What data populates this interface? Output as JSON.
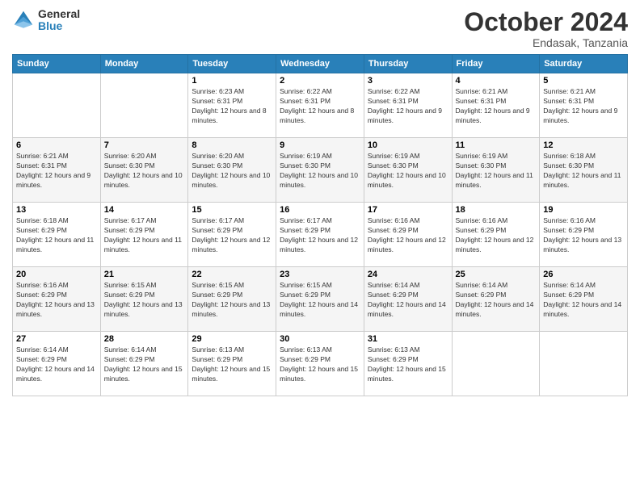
{
  "logo": {
    "text_general": "General",
    "text_blue": "Blue"
  },
  "header": {
    "title": "October 2024",
    "subtitle": "Endasak, Tanzania"
  },
  "weekdays": [
    "Sunday",
    "Monday",
    "Tuesday",
    "Wednesday",
    "Thursday",
    "Friday",
    "Saturday"
  ],
  "weeks": [
    [
      {
        "day": "",
        "info": ""
      },
      {
        "day": "",
        "info": ""
      },
      {
        "day": "1",
        "info": "Sunrise: 6:23 AM\nSunset: 6:31 PM\nDaylight: 12 hours and 8 minutes."
      },
      {
        "day": "2",
        "info": "Sunrise: 6:22 AM\nSunset: 6:31 PM\nDaylight: 12 hours and 8 minutes."
      },
      {
        "day": "3",
        "info": "Sunrise: 6:22 AM\nSunset: 6:31 PM\nDaylight: 12 hours and 9 minutes."
      },
      {
        "day": "4",
        "info": "Sunrise: 6:21 AM\nSunset: 6:31 PM\nDaylight: 12 hours and 9 minutes."
      },
      {
        "day": "5",
        "info": "Sunrise: 6:21 AM\nSunset: 6:31 PM\nDaylight: 12 hours and 9 minutes."
      }
    ],
    [
      {
        "day": "6",
        "info": "Sunrise: 6:21 AM\nSunset: 6:31 PM\nDaylight: 12 hours and 9 minutes."
      },
      {
        "day": "7",
        "info": "Sunrise: 6:20 AM\nSunset: 6:30 PM\nDaylight: 12 hours and 10 minutes."
      },
      {
        "day": "8",
        "info": "Sunrise: 6:20 AM\nSunset: 6:30 PM\nDaylight: 12 hours and 10 minutes."
      },
      {
        "day": "9",
        "info": "Sunrise: 6:19 AM\nSunset: 6:30 PM\nDaylight: 12 hours and 10 minutes."
      },
      {
        "day": "10",
        "info": "Sunrise: 6:19 AM\nSunset: 6:30 PM\nDaylight: 12 hours and 10 minutes."
      },
      {
        "day": "11",
        "info": "Sunrise: 6:19 AM\nSunset: 6:30 PM\nDaylight: 12 hours and 11 minutes."
      },
      {
        "day": "12",
        "info": "Sunrise: 6:18 AM\nSunset: 6:30 PM\nDaylight: 12 hours and 11 minutes."
      }
    ],
    [
      {
        "day": "13",
        "info": "Sunrise: 6:18 AM\nSunset: 6:29 PM\nDaylight: 12 hours and 11 minutes."
      },
      {
        "day": "14",
        "info": "Sunrise: 6:17 AM\nSunset: 6:29 PM\nDaylight: 12 hours and 11 minutes."
      },
      {
        "day": "15",
        "info": "Sunrise: 6:17 AM\nSunset: 6:29 PM\nDaylight: 12 hours and 12 minutes."
      },
      {
        "day": "16",
        "info": "Sunrise: 6:17 AM\nSunset: 6:29 PM\nDaylight: 12 hours and 12 minutes."
      },
      {
        "day": "17",
        "info": "Sunrise: 6:16 AM\nSunset: 6:29 PM\nDaylight: 12 hours and 12 minutes."
      },
      {
        "day": "18",
        "info": "Sunrise: 6:16 AM\nSunset: 6:29 PM\nDaylight: 12 hours and 12 minutes."
      },
      {
        "day": "19",
        "info": "Sunrise: 6:16 AM\nSunset: 6:29 PM\nDaylight: 12 hours and 13 minutes."
      }
    ],
    [
      {
        "day": "20",
        "info": "Sunrise: 6:16 AM\nSunset: 6:29 PM\nDaylight: 12 hours and 13 minutes."
      },
      {
        "day": "21",
        "info": "Sunrise: 6:15 AM\nSunset: 6:29 PM\nDaylight: 12 hours and 13 minutes."
      },
      {
        "day": "22",
        "info": "Sunrise: 6:15 AM\nSunset: 6:29 PM\nDaylight: 12 hours and 13 minutes."
      },
      {
        "day": "23",
        "info": "Sunrise: 6:15 AM\nSunset: 6:29 PM\nDaylight: 12 hours and 14 minutes."
      },
      {
        "day": "24",
        "info": "Sunrise: 6:14 AM\nSunset: 6:29 PM\nDaylight: 12 hours and 14 minutes."
      },
      {
        "day": "25",
        "info": "Sunrise: 6:14 AM\nSunset: 6:29 PM\nDaylight: 12 hours and 14 minutes."
      },
      {
        "day": "26",
        "info": "Sunrise: 6:14 AM\nSunset: 6:29 PM\nDaylight: 12 hours and 14 minutes."
      }
    ],
    [
      {
        "day": "27",
        "info": "Sunrise: 6:14 AM\nSunset: 6:29 PM\nDaylight: 12 hours and 14 minutes."
      },
      {
        "day": "28",
        "info": "Sunrise: 6:14 AM\nSunset: 6:29 PM\nDaylight: 12 hours and 15 minutes."
      },
      {
        "day": "29",
        "info": "Sunrise: 6:13 AM\nSunset: 6:29 PM\nDaylight: 12 hours and 15 minutes."
      },
      {
        "day": "30",
        "info": "Sunrise: 6:13 AM\nSunset: 6:29 PM\nDaylight: 12 hours and 15 minutes."
      },
      {
        "day": "31",
        "info": "Sunrise: 6:13 AM\nSunset: 6:29 PM\nDaylight: 12 hours and 15 minutes."
      },
      {
        "day": "",
        "info": ""
      },
      {
        "day": "",
        "info": ""
      }
    ]
  ]
}
